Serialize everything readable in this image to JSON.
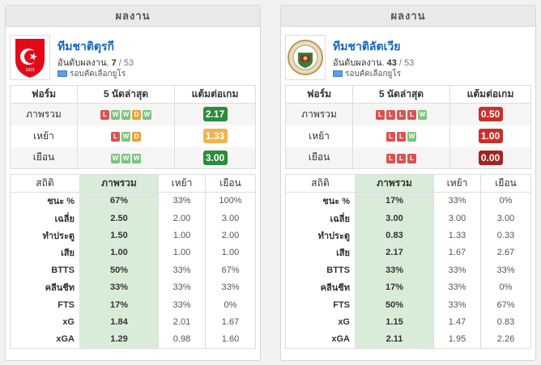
{
  "teams": [
    {
      "header": "ผลงาน",
      "name": "ทีมชาติตุรกี",
      "rank_prefix": "อันดับผลงาน.",
      "rank": "7",
      "rank_sep": " / ",
      "rank_total": "53",
      "competition": "รอบคัดเลือกยูโร",
      "logo_icon": "turkey-crest-icon",
      "form_headers": [
        "ฟอร์ม",
        "5 นัดล่าสุด",
        "แต้มต่อเกม"
      ],
      "form_rows": [
        {
          "label": "ภาพรวม",
          "results": [
            "L",
            "W",
            "W",
            "D",
            "W"
          ],
          "ppg": "2.17",
          "ppg_color": "green"
        },
        {
          "label": "เหย้า",
          "results": [
            "L",
            "W",
            "D"
          ],
          "ppg": "1.33",
          "ppg_color": "orange"
        },
        {
          "label": "เยือน",
          "results": [
            "W",
            "W",
            "W"
          ],
          "ppg": "3.00",
          "ppg_color": "green"
        }
      ],
      "stats_headers": [
        "สถิติ",
        "ภาพรวม",
        "เหย้า",
        "เยือน"
      ],
      "stats_rows": [
        {
          "label": "ชนะ %",
          "all": "67%",
          "home": "33%",
          "away": "100%"
        },
        {
          "label": "เฉลี่ย",
          "all": "2.50",
          "home": "2.00",
          "away": "3.00"
        },
        {
          "label": "ทำประตู",
          "all": "1.50",
          "home": "1.00",
          "away": "2.00"
        },
        {
          "label": "เสีย",
          "all": "1.00",
          "home": "1.00",
          "away": "1.00"
        },
        {
          "label": "BTTS",
          "all": "50%",
          "home": "33%",
          "away": "67%"
        },
        {
          "label": "คลีนชีท",
          "all": "33%",
          "home": "33%",
          "away": "33%"
        },
        {
          "label": "FTS",
          "all": "17%",
          "home": "33%",
          "away": "0%"
        },
        {
          "label": "xG",
          "all": "1.84",
          "home": "2.01",
          "away": "1.67"
        },
        {
          "label": "xGA",
          "all": "1.29",
          "home": "0.98",
          "away": "1.60"
        }
      ]
    },
    {
      "header": "ผลงาน",
      "name": "ทีมชาติลัตเวีย",
      "rank_prefix": "อันดับผลงาน.",
      "rank": "43",
      "rank_sep": " / ",
      "rank_total": "53",
      "competition": "รอบคัดเลือกยูโร",
      "logo_icon": "latvia-crest-icon",
      "form_headers": [
        "ฟอร์ม",
        "5 นัดล่าสุด",
        "แต้มต่อเกม"
      ],
      "form_rows": [
        {
          "label": "ภาพรวม",
          "results": [
            "L",
            "L",
            "L",
            "L",
            "W"
          ],
          "ppg": "0.50",
          "ppg_color": "red"
        },
        {
          "label": "เหย้า",
          "results": [
            "L",
            "L",
            "W"
          ],
          "ppg": "1.00",
          "ppg_color": "red"
        },
        {
          "label": "เยือน",
          "results": [
            "L",
            "L",
            "L"
          ],
          "ppg": "0.00",
          "ppg_color": "darkred"
        }
      ],
      "stats_headers": [
        "สถิติ",
        "ภาพรวม",
        "เหย้า",
        "เยือน"
      ],
      "stats_rows": [
        {
          "label": "ชนะ %",
          "all": "17%",
          "home": "33%",
          "away": "0%"
        },
        {
          "label": "เฉลี่ย",
          "all": "3.00",
          "home": "3.00",
          "away": "3.00"
        },
        {
          "label": "ทำประตู",
          "all": "0.83",
          "home": "1.33",
          "away": "0.33"
        },
        {
          "label": "เสีย",
          "all": "2.17",
          "home": "1.67",
          "away": "2.67"
        },
        {
          "label": "BTTS",
          "all": "33%",
          "home": "33%",
          "away": "33%"
        },
        {
          "label": "คลีนชีท",
          "all": "17%",
          "home": "33%",
          "away": "0%"
        },
        {
          "label": "FTS",
          "all": "50%",
          "home": "33%",
          "away": "67%"
        },
        {
          "label": "xG",
          "all": "1.15",
          "home": "1.47",
          "away": "0.83"
        },
        {
          "label": "xGA",
          "all": "2.11",
          "home": "1.95",
          "away": "2.26"
        }
      ]
    }
  ],
  "colors": {
    "highlight_column": "#d9ecd9",
    "team_link": "#1565c0",
    "win": "#7dc47d",
    "loss": "#d9534f",
    "draw": "#e8a23c"
  }
}
